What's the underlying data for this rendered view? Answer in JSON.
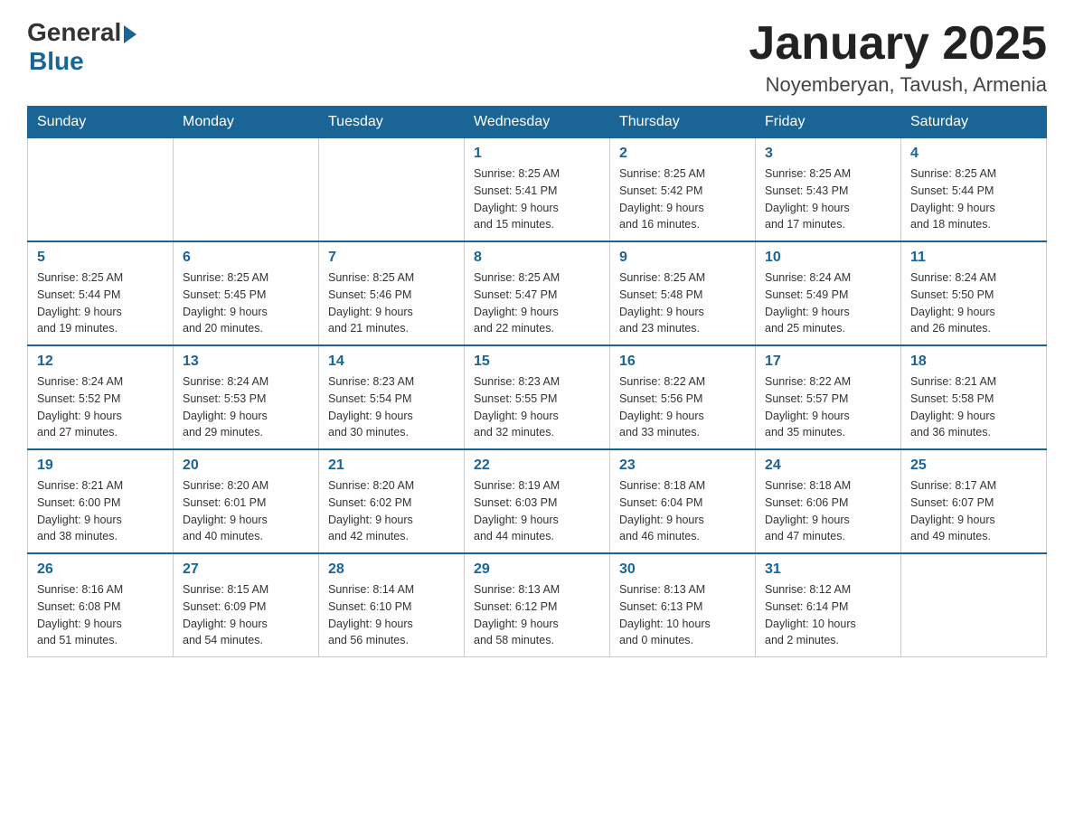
{
  "logo": {
    "general": "General",
    "blue": "Blue"
  },
  "title": {
    "month_year": "January 2025",
    "location": "Noyemberyan, Tavush, Armenia"
  },
  "days_of_week": [
    "Sunday",
    "Monday",
    "Tuesday",
    "Wednesday",
    "Thursday",
    "Friday",
    "Saturday"
  ],
  "weeks": [
    [
      {
        "day": "",
        "info": ""
      },
      {
        "day": "",
        "info": ""
      },
      {
        "day": "",
        "info": ""
      },
      {
        "day": "1",
        "info": "Sunrise: 8:25 AM\nSunset: 5:41 PM\nDaylight: 9 hours\nand 15 minutes."
      },
      {
        "day": "2",
        "info": "Sunrise: 8:25 AM\nSunset: 5:42 PM\nDaylight: 9 hours\nand 16 minutes."
      },
      {
        "day": "3",
        "info": "Sunrise: 8:25 AM\nSunset: 5:43 PM\nDaylight: 9 hours\nand 17 minutes."
      },
      {
        "day": "4",
        "info": "Sunrise: 8:25 AM\nSunset: 5:44 PM\nDaylight: 9 hours\nand 18 minutes."
      }
    ],
    [
      {
        "day": "5",
        "info": "Sunrise: 8:25 AM\nSunset: 5:44 PM\nDaylight: 9 hours\nand 19 minutes."
      },
      {
        "day": "6",
        "info": "Sunrise: 8:25 AM\nSunset: 5:45 PM\nDaylight: 9 hours\nand 20 minutes."
      },
      {
        "day": "7",
        "info": "Sunrise: 8:25 AM\nSunset: 5:46 PM\nDaylight: 9 hours\nand 21 minutes."
      },
      {
        "day": "8",
        "info": "Sunrise: 8:25 AM\nSunset: 5:47 PM\nDaylight: 9 hours\nand 22 minutes."
      },
      {
        "day": "9",
        "info": "Sunrise: 8:25 AM\nSunset: 5:48 PM\nDaylight: 9 hours\nand 23 minutes."
      },
      {
        "day": "10",
        "info": "Sunrise: 8:24 AM\nSunset: 5:49 PM\nDaylight: 9 hours\nand 25 minutes."
      },
      {
        "day": "11",
        "info": "Sunrise: 8:24 AM\nSunset: 5:50 PM\nDaylight: 9 hours\nand 26 minutes."
      }
    ],
    [
      {
        "day": "12",
        "info": "Sunrise: 8:24 AM\nSunset: 5:52 PM\nDaylight: 9 hours\nand 27 minutes."
      },
      {
        "day": "13",
        "info": "Sunrise: 8:24 AM\nSunset: 5:53 PM\nDaylight: 9 hours\nand 29 minutes."
      },
      {
        "day": "14",
        "info": "Sunrise: 8:23 AM\nSunset: 5:54 PM\nDaylight: 9 hours\nand 30 minutes."
      },
      {
        "day": "15",
        "info": "Sunrise: 8:23 AM\nSunset: 5:55 PM\nDaylight: 9 hours\nand 32 minutes."
      },
      {
        "day": "16",
        "info": "Sunrise: 8:22 AM\nSunset: 5:56 PM\nDaylight: 9 hours\nand 33 minutes."
      },
      {
        "day": "17",
        "info": "Sunrise: 8:22 AM\nSunset: 5:57 PM\nDaylight: 9 hours\nand 35 minutes."
      },
      {
        "day": "18",
        "info": "Sunrise: 8:21 AM\nSunset: 5:58 PM\nDaylight: 9 hours\nand 36 minutes."
      }
    ],
    [
      {
        "day": "19",
        "info": "Sunrise: 8:21 AM\nSunset: 6:00 PM\nDaylight: 9 hours\nand 38 minutes."
      },
      {
        "day": "20",
        "info": "Sunrise: 8:20 AM\nSunset: 6:01 PM\nDaylight: 9 hours\nand 40 minutes."
      },
      {
        "day": "21",
        "info": "Sunrise: 8:20 AM\nSunset: 6:02 PM\nDaylight: 9 hours\nand 42 minutes."
      },
      {
        "day": "22",
        "info": "Sunrise: 8:19 AM\nSunset: 6:03 PM\nDaylight: 9 hours\nand 44 minutes."
      },
      {
        "day": "23",
        "info": "Sunrise: 8:18 AM\nSunset: 6:04 PM\nDaylight: 9 hours\nand 46 minutes."
      },
      {
        "day": "24",
        "info": "Sunrise: 8:18 AM\nSunset: 6:06 PM\nDaylight: 9 hours\nand 47 minutes."
      },
      {
        "day": "25",
        "info": "Sunrise: 8:17 AM\nSunset: 6:07 PM\nDaylight: 9 hours\nand 49 minutes."
      }
    ],
    [
      {
        "day": "26",
        "info": "Sunrise: 8:16 AM\nSunset: 6:08 PM\nDaylight: 9 hours\nand 51 minutes."
      },
      {
        "day": "27",
        "info": "Sunrise: 8:15 AM\nSunset: 6:09 PM\nDaylight: 9 hours\nand 54 minutes."
      },
      {
        "day": "28",
        "info": "Sunrise: 8:14 AM\nSunset: 6:10 PM\nDaylight: 9 hours\nand 56 minutes."
      },
      {
        "day": "29",
        "info": "Sunrise: 8:13 AM\nSunset: 6:12 PM\nDaylight: 9 hours\nand 58 minutes."
      },
      {
        "day": "30",
        "info": "Sunrise: 8:13 AM\nSunset: 6:13 PM\nDaylight: 10 hours\nand 0 minutes."
      },
      {
        "day": "31",
        "info": "Sunrise: 8:12 AM\nSunset: 6:14 PM\nDaylight: 10 hours\nand 2 minutes."
      },
      {
        "day": "",
        "info": ""
      }
    ]
  ]
}
